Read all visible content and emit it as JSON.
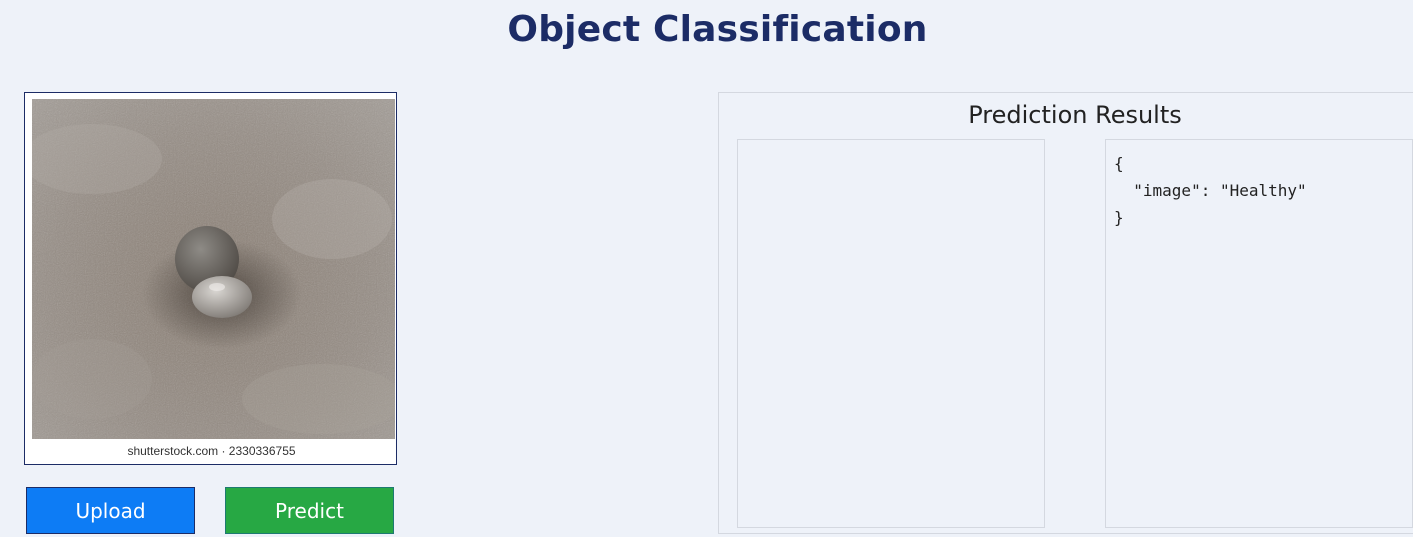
{
  "header": {
    "title": "Object Classification"
  },
  "image_panel": {
    "watermark": "shutterstock.com · 2330336755"
  },
  "buttons": {
    "upload_label": "Upload",
    "predict_label": "Predict"
  },
  "results": {
    "title": "Prediction Results",
    "json_lines": [
      "{",
      "  \"image\": \"Healthy\"",
      "}"
    ]
  },
  "colors": {
    "title": "#1c2c66",
    "upload": "#0d7cf5",
    "predict": "#27a844",
    "background": "#eef2f9"
  }
}
